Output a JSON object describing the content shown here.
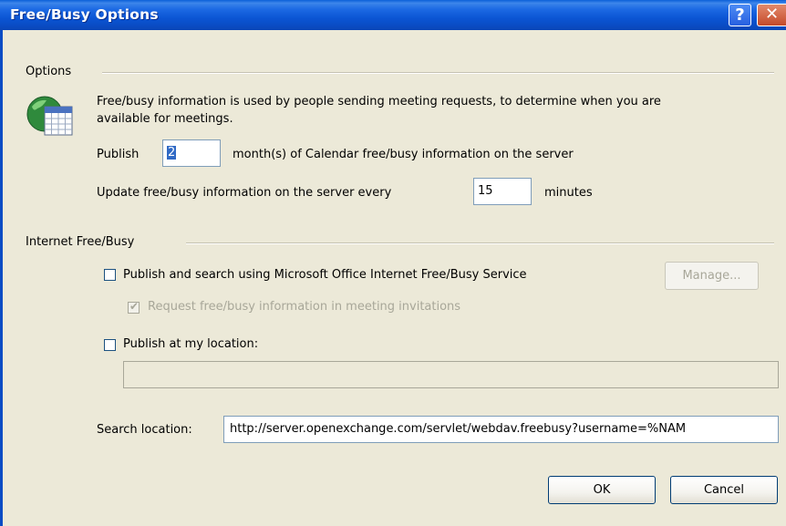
{
  "window": {
    "title": "Free/Busy Options"
  },
  "options": {
    "group_label": "Options",
    "description": "Free/busy information is used by people sending meeting requests, to determine when you are available for meetings.",
    "publish_label": "Publish",
    "publish_months_value": "2",
    "publish_suffix": "month(s) of Calendar free/busy information on the server",
    "update_label": "Update free/busy information on the server every",
    "update_minutes_value": "15",
    "update_suffix": "minutes"
  },
  "internet": {
    "group_label": "Internet Free/Busy",
    "ms_service_label": "Publish and search using Microsoft Office Internet Free/Busy Service",
    "ms_service_checked": false,
    "manage_label": "Manage...",
    "request_label": "Request free/busy information in meeting invitations",
    "request_checked": true,
    "publish_location_label": "Publish at my location:",
    "publish_location_checked": false,
    "publish_location_value": "",
    "search_location_label": "Search location:",
    "search_location_value": "http://server.openexchange.com/servlet/webdav.freebusy?username=%NAM"
  },
  "buttons": {
    "ok_label": "OK",
    "cancel_label": "Cancel"
  },
  "icons": {
    "help": "help-icon",
    "close": "close-icon",
    "calendar": "calendar-globe-icon"
  },
  "colors": {
    "titlebar": "#0a4cc4",
    "dialog_bg": "#ece9d8",
    "close_button": "#c64a2a"
  }
}
